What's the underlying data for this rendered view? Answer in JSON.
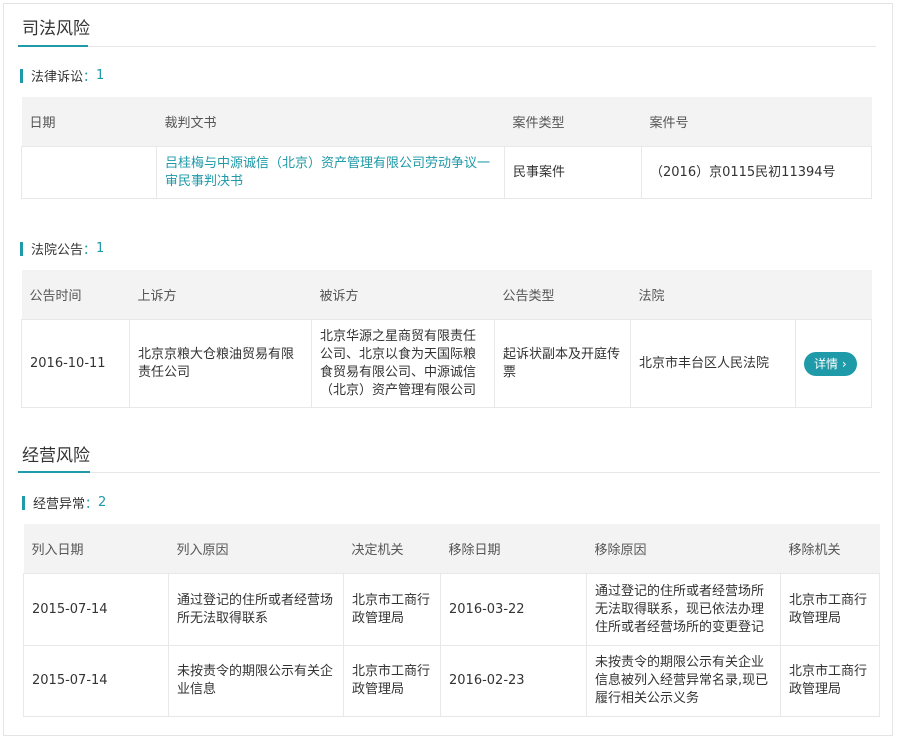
{
  "judicial": {
    "title": "司法风险",
    "lawsuit": {
      "label": "法律诉讼",
      "sep": "：",
      "count": "1",
      "headers": [
        "日期",
        "裁判文书",
        "案件类型",
        "案件号"
      ],
      "rows": [
        {
          "date": "",
          "document": "吕桂梅与中源诚信（北京）资产管理有限公司劳动争议一审民事判决书",
          "type": "民事案件",
          "case_no": "（2016）京0115民初11394号"
        }
      ]
    },
    "court_notice": {
      "label": "法院公告",
      "sep": "：",
      "count": "1",
      "headers": [
        "公告时间",
        "上诉方",
        "被诉方",
        "公告类型",
        "法院",
        ""
      ],
      "rows": [
        {
          "date": "2016-10-11",
          "appellant": "北京京粮大仓粮油贸易有限责任公司",
          "defendant": "北京华源之星商贸有限责任公司、北京以食为天国际粮食贸易有限公司、中源诚信（北京）资产管理有限公司",
          "type": "起诉状副本及开庭传票",
          "court": "北京市丰台区人民法院",
          "action": "详情 ›"
        }
      ]
    }
  },
  "business": {
    "title": "经营风险",
    "abnormal": {
      "label": "经营异常",
      "sep": "：",
      "count": "2",
      "headers": [
        "列入日期",
        "列入原因",
        "决定机关",
        "移除日期",
        "移除原因",
        "移除机关"
      ],
      "rows": [
        {
          "in_date": "2015-07-14",
          "in_reason": "通过登记的住所或者经营场所无法取得联系",
          "authority": "北京市工商行政管理局",
          "out_date": "2016-03-22",
          "out_reason": "通过登记的住所或者经营场所无法取得联系，现已依法办理住所或者经营场所的变更登记",
          "out_authority": "北京市工商行政管理局"
        },
        {
          "in_date": "2015-07-14",
          "in_reason": "未按责令的期限公示有关企业信息",
          "authority": "北京市工商行政管理局",
          "out_date": "2016-02-23",
          "out_reason": "未按责令的期限公示有关企业信息被列入经营异常名录,现已履行相关公示义务",
          "out_authority": "北京市工商行政管理局"
        }
      ]
    }
  },
  "colors": {
    "accent": "#1e9aa8",
    "header_bg": "#f3f3f3",
    "border": "#e8e8e8"
  }
}
